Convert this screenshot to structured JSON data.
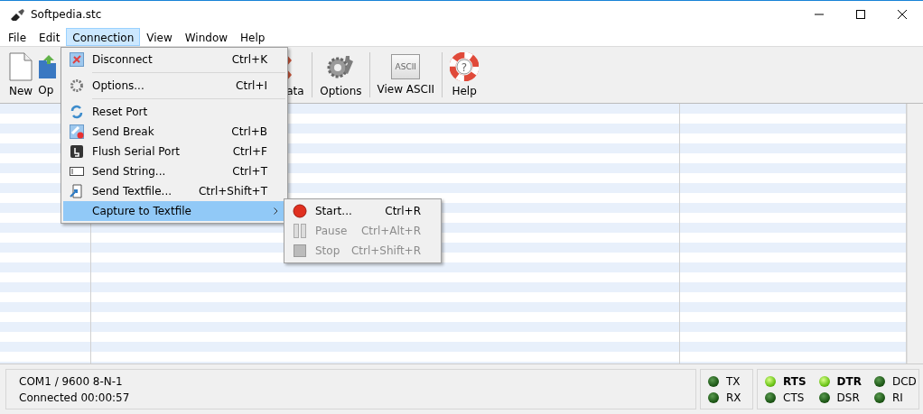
{
  "window": {
    "title": "Softpedia.stc"
  },
  "menu_bar": [
    {
      "label": "File",
      "selected": false
    },
    {
      "label": "Edit",
      "selected": false
    },
    {
      "label": "Connection",
      "selected": true
    },
    {
      "label": "View",
      "selected": false
    },
    {
      "label": "Window",
      "selected": false
    },
    {
      "label": "Help",
      "selected": false
    }
  ],
  "toolbar": [
    {
      "kind": "new",
      "label": "New"
    },
    {
      "kind": "open",
      "label": "Op"
    },
    {
      "kind": "gap"
    },
    {
      "kind": "data",
      "label": "ata"
    },
    {
      "kind": "options",
      "label": "Options"
    },
    {
      "kind": "ascii",
      "label": "View ASCII",
      "icon_text": "ASCII"
    },
    {
      "kind": "help",
      "label": "Help",
      "icon_text": "?"
    }
  ],
  "connection_menu": [
    {
      "kind": "disconnect",
      "label": "Disconnect",
      "shortcut": "Ctrl+K",
      "selected": false,
      "separator_after": true
    },
    {
      "kind": "options",
      "label": "Options...",
      "shortcut": "Ctrl+I",
      "selected": false,
      "separator_after": true
    },
    {
      "kind": "reset",
      "label": "Reset Port",
      "selected": false,
      "separator_after": false
    },
    {
      "kind": "break",
      "label": "Send Break",
      "shortcut": "Ctrl+B",
      "selected": false,
      "separator_after": false
    },
    {
      "kind": "flush",
      "label": "Flush Serial Port",
      "shortcut": "Ctrl+F",
      "selected": false,
      "separator_after": false
    },
    {
      "kind": "string",
      "label": "Send String...",
      "shortcut": "Ctrl+T",
      "selected": false,
      "separator_after": false
    },
    {
      "kind": "textfile",
      "label": "Send Textfile...",
      "shortcut": "Ctrl+Shift+T",
      "selected": false,
      "separator_after": false
    },
    {
      "kind": "submenu",
      "label": "Capture to Textfile",
      "selected": true,
      "separator_after": false
    }
  ],
  "capture_submenu": [
    {
      "kind": "record",
      "label": "Start...",
      "shortcut": "Ctrl+R",
      "disabled": false
    },
    {
      "kind": "pause",
      "label": "Pause",
      "shortcut": "Ctrl+Alt+R",
      "disabled": true
    },
    {
      "kind": "stop",
      "label": "Stop",
      "shortcut": "Ctrl+Shift+R",
      "disabled": true
    }
  ],
  "status_bar": {
    "port": "COM1 / 9600 8-N-1",
    "connection": "Connected 00:00:57",
    "data_leds": [
      {
        "label": "TX",
        "on": false
      },
      {
        "label": "RX",
        "on": false
      }
    ],
    "line_leds": [
      {
        "label": "RTS",
        "on": true
      },
      {
        "label": "CTS",
        "on": false
      },
      {
        "label": "DTR",
        "on": true
      },
      {
        "label": "DSR",
        "on": false
      },
      {
        "label": "DCD",
        "on": false
      },
      {
        "label": "RI",
        "on": false
      }
    ]
  }
}
